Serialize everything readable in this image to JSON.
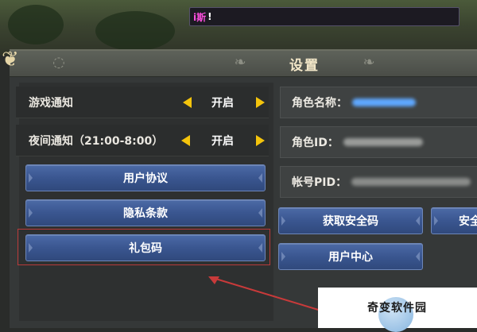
{
  "chat": {
    "tag": "i斯",
    "message": "!"
  },
  "settings": {
    "title": "设置"
  },
  "toggles": [
    {
      "label": "游戏通知",
      "value": "开启"
    },
    {
      "label": "夜间通知（21:00-8:00）",
      "value": "开启"
    }
  ],
  "buttons": {
    "user_agreement": "用户协议",
    "privacy_policy": "隐私条款",
    "gift_code": "礼包码",
    "get_security_code": "获取安全码",
    "security_partial": "安全",
    "user_center": "用户中心"
  },
  "info": {
    "role_name_label": "角色名称：",
    "role_id_label": "角色ID：",
    "account_pid_label": "帐号PID："
  },
  "watermark": {
    "text": "奇变软件园"
  },
  "colors": {
    "accent_yellow": "#f4c40c",
    "button_blue": "#3a5690",
    "annotation_red": "#c83a3a"
  }
}
